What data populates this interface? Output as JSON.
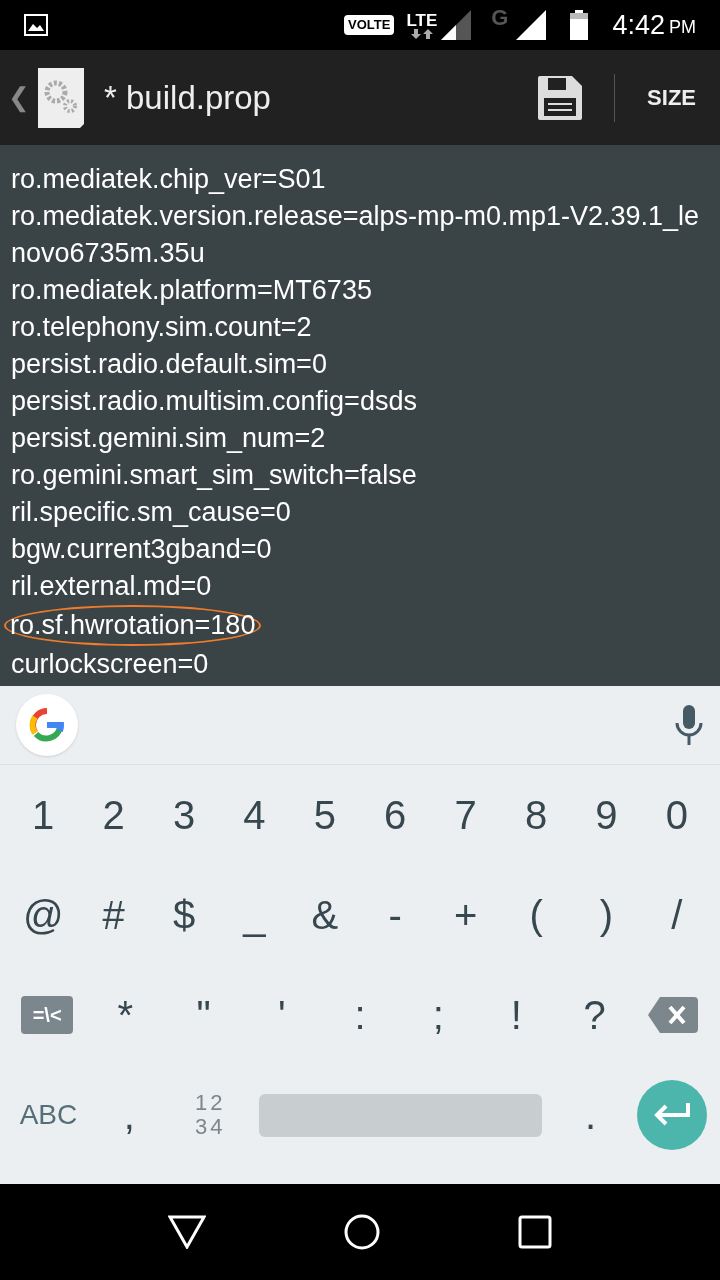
{
  "status_bar": {
    "volte": "VOLTE",
    "network": "LTE",
    "network_2": "G",
    "time": "4:42",
    "ampm": "PM"
  },
  "app_bar": {
    "back": "❮",
    "title": "* build.prop",
    "action": "SIZE"
  },
  "editor": {
    "lines": [
      {
        "text": "ro.mediatek.chip_ver=S01",
        "highlighted": false
      },
      {
        "text": "ro.mediatek.version.release=alps-mp-m0.mp1-V2.39.1_lenovo6735m.35u",
        "highlighted": false
      },
      {
        "text": "ro.mediatek.platform=MT6735",
        "highlighted": false
      },
      {
        "text": "ro.telephony.sim.count=2",
        "highlighted": false
      },
      {
        "text": "persist.radio.default.sim=0",
        "highlighted": false
      },
      {
        "text": "persist.radio.multisim.config=dsds",
        "highlighted": false
      },
      {
        "text": "persist.gemini.sim_num=2",
        "highlighted": false
      },
      {
        "text": "ro.gemini.smart_sim_switch=false",
        "highlighted": false
      },
      {
        "text": "ril.specific.sm_cause=0",
        "highlighted": false
      },
      {
        "text": "bgw.current3gband=0",
        "highlighted": false
      },
      {
        "text": "ril.external.md=0",
        "highlighted": false
      },
      {
        "text": "ro.sf.hwrotation=180",
        "highlighted": true
      },
      {
        "text": "curlockscreen=0",
        "highlighted": false
      }
    ]
  },
  "keyboard": {
    "rows": [
      [
        {
          "kind": "char",
          "label": "1"
        },
        {
          "kind": "char",
          "label": "2"
        },
        {
          "kind": "char",
          "label": "3"
        },
        {
          "kind": "char",
          "label": "4"
        },
        {
          "kind": "char",
          "label": "5"
        },
        {
          "kind": "char",
          "label": "6"
        },
        {
          "kind": "char",
          "label": "7"
        },
        {
          "kind": "char",
          "label": "8"
        },
        {
          "kind": "char",
          "label": "9"
        },
        {
          "kind": "char",
          "label": "0"
        }
      ],
      [
        {
          "kind": "char",
          "label": "@"
        },
        {
          "kind": "char",
          "label": "#"
        },
        {
          "kind": "char",
          "label": "$"
        },
        {
          "kind": "char",
          "label": "_"
        },
        {
          "kind": "char",
          "label": "&"
        },
        {
          "kind": "char",
          "label": "-"
        },
        {
          "kind": "char",
          "label": "+"
        },
        {
          "kind": "char",
          "label": "("
        },
        {
          "kind": "char",
          "label": ")"
        },
        {
          "kind": "char",
          "label": "/"
        }
      ],
      [
        {
          "kind": "toggle",
          "label": "=\\<"
        },
        {
          "kind": "char",
          "label": "*"
        },
        {
          "kind": "char",
          "label": "\""
        },
        {
          "kind": "char",
          "label": "'"
        },
        {
          "kind": "char",
          "label": ":"
        },
        {
          "kind": "char",
          "label": ";"
        },
        {
          "kind": "char",
          "label": "!"
        },
        {
          "kind": "char",
          "label": "?"
        },
        {
          "kind": "backspace"
        }
      ],
      [
        {
          "kind": "text",
          "label": "ABC"
        },
        {
          "kind": "char",
          "label": ","
        },
        {
          "kind": "numpad",
          "lines": [
            "12",
            "34"
          ]
        },
        {
          "kind": "space"
        },
        {
          "kind": "char",
          "label": "."
        },
        {
          "kind": "enter"
        }
      ]
    ]
  }
}
